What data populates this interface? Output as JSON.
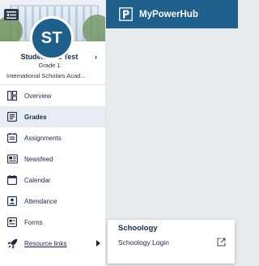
{
  "header": {
    "brand": "MyPowerHub"
  },
  "profile": {
    "initials": "ST",
    "name": "StudentES1 Test",
    "grade": "Grade 1",
    "school": "International Scholars Acad..."
  },
  "nav": {
    "items": [
      {
        "label": "Overview",
        "icon": "overview-icon"
      },
      {
        "label": "Grades",
        "icon": "grades-icon",
        "active": true
      },
      {
        "label": "Assignments",
        "icon": "assignments-icon"
      },
      {
        "label": "Newsfeed",
        "icon": "newsfeed-icon"
      },
      {
        "label": "Calendar",
        "icon": "calendar-icon"
      },
      {
        "label": "Attendance",
        "icon": "attendance-icon"
      },
      {
        "label": "Forms",
        "icon": "forms-icon"
      },
      {
        "label": "Resource links",
        "icon": "rocket-icon"
      }
    ]
  },
  "popup": {
    "title": "Schoology",
    "link_label": "Schoology Login"
  },
  "colors": {
    "brand": "#1f5f8b",
    "active_bg": "#e7ecf5",
    "text": "#1b2a44"
  }
}
